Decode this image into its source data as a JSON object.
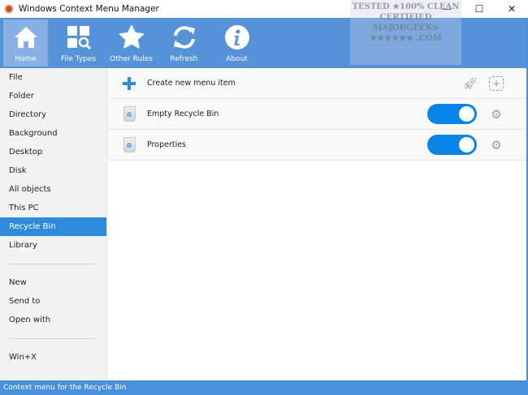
{
  "window": {
    "title": "Windows Context Menu Manager",
    "minimize": "—",
    "maximize": "☐",
    "close": "✕"
  },
  "toolbar": {
    "items": [
      {
        "label": "Home",
        "icon": "home-icon",
        "active": true
      },
      {
        "label": "File Types",
        "icon": "file-types-icon"
      },
      {
        "label": "Other Rules",
        "icon": "star-icon"
      },
      {
        "label": "Refresh",
        "icon": "refresh-icon"
      },
      {
        "label": "About",
        "icon": "info-icon"
      }
    ]
  },
  "watermark": {
    "line1": "TESTED ★100% CLEAN",
    "line2": "CERTIFIED",
    "line3": "MAJORGEEKS",
    "line4": "★★★★★★ .COM"
  },
  "sidebar": {
    "group1": [
      "File",
      "Folder",
      "Directory",
      "Background",
      "Desktop",
      "Disk",
      "All objects",
      "This PC",
      "Recycle Bin",
      "Library"
    ],
    "group2": [
      "New",
      "Send to",
      "Open with"
    ],
    "group3": [
      "Win+X"
    ],
    "selected": "Recycle Bin"
  },
  "main": {
    "create_label": "Create new menu item",
    "items": [
      {
        "label": "Empty Recycle Bin",
        "enabled": true
      },
      {
        "label": "Properties",
        "enabled": true
      }
    ]
  },
  "colors": {
    "accent": "#5592d8",
    "toggle": "#0a84e6",
    "selected": "#2f8adb"
  },
  "status": "Context menu for the Recycle Bin"
}
